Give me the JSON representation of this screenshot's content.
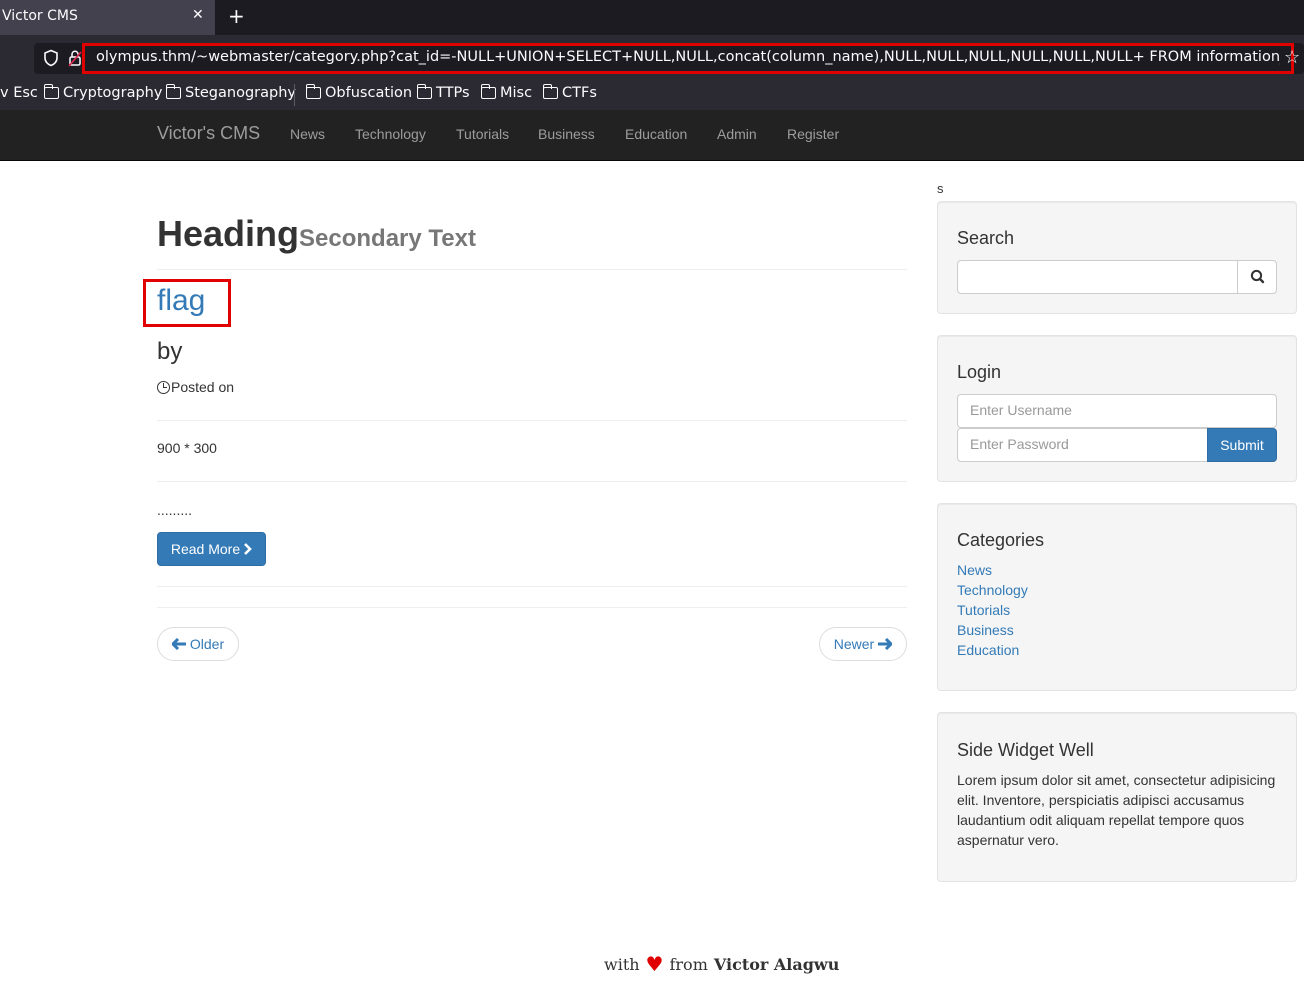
{
  "browser": {
    "tab_title": "Victor CMS",
    "tab_close": "✕",
    "new_tab": "+",
    "url": "olympus.thm/~webmaster/category.php?cat_id=-NULL+UNION+SELECT+NULL,NULL,concat(column_name),NULL,NULL,NULL,NULL,NULL,NULL+ FROM information_s",
    "bookmarks": [
      "v Esc",
      "Cryptography",
      "Steganography",
      "Obfuscation",
      "TTPs",
      "Misc",
      "CTFs"
    ]
  },
  "navbar": {
    "brand": "Victor's CMS",
    "links": [
      "News",
      "Technology",
      "Tutorials",
      "Business",
      "Education",
      "Admin",
      "Register"
    ]
  },
  "main": {
    "stray_text": "s",
    "heading": "Heading",
    "heading_secondary": "Secondary Text",
    "post_title": "flag",
    "by": "by",
    "posted_on": "Posted on",
    "image_dims": "900 * 300",
    "excerpt": ".........",
    "read_more": "Read More",
    "older": "Older",
    "newer": "Newer"
  },
  "sidebar": {
    "search_title": "Search",
    "login_title": "Login",
    "username_placeholder": "Enter Username",
    "password_placeholder": "Enter Password",
    "submit": "Submit",
    "categories_title": "Categories",
    "categories": [
      "News",
      "Technology",
      "Tutorials",
      "Business",
      "Education"
    ],
    "widget_title": "Side Widget Well",
    "widget_text": "Lorem ipsum dolor sit amet, consectetur adipisicing elit. Inventore, perspiciatis adipisci accusamus laudantium odit aliquam repellat tempore quos aspernatur vero."
  },
  "footer": {
    "with": "with",
    "heart": "♥",
    "from": "from",
    "author": "Victor Alagwu"
  },
  "colors": {
    "link": "#337ab7",
    "highlight": "#e00000",
    "navbar_bg": "#222222"
  }
}
